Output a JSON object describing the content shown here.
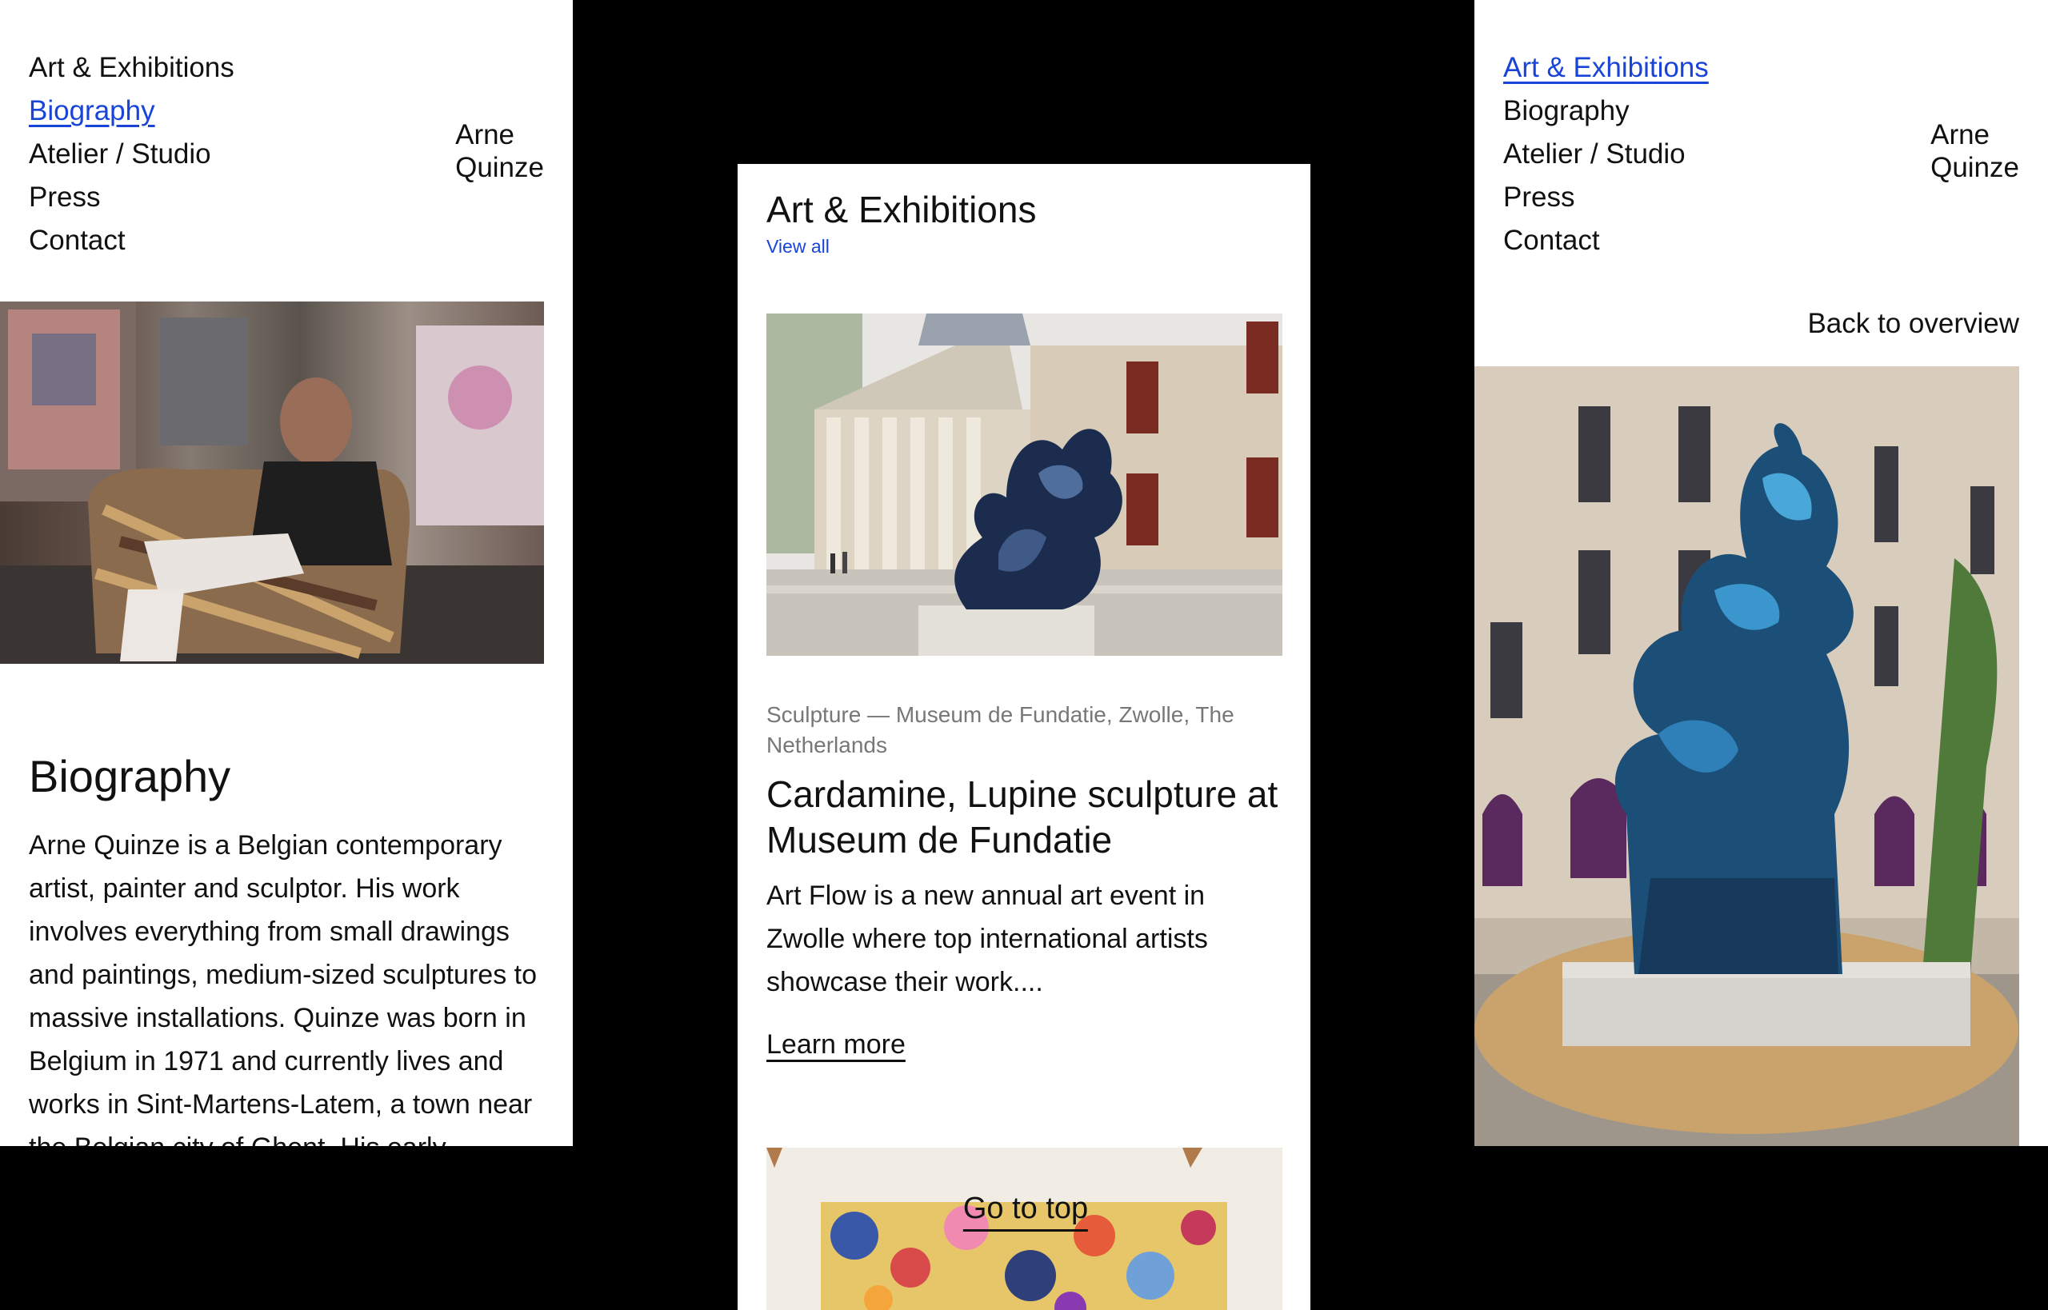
{
  "nav": {
    "items": [
      "Art & Exhibitions",
      "Biography",
      "Atelier / Studio",
      "Press",
      "Contact"
    ]
  },
  "brand": {
    "line1": "Arne",
    "line2": "Quinze"
  },
  "biography": {
    "title": "Biography",
    "text": "Arne Quinze is a Belgian contemporary artist, painter and sculptor. His work involves everything from small drawings and paintings, medium-sized sculptures to massive installations. Quinze was born in Belgium in 1971 and currently lives and works in Sint-Martens-Latem, a town near the Belgian city of Ghent. His early"
  },
  "exhibitions": {
    "title": "Art & Exhibitions",
    "view_all": "View all",
    "card": {
      "meta": "Sculpture — Museum de Fundatie, Zwolle, The Netherlands",
      "title": "Cardamine, Lupine sculpture at Museum de Fundatie",
      "excerpt": "Art Flow is a new annual art event in Zwolle where top international artists showcase their work....",
      "cta": "Learn more"
    },
    "go_to_top": "Go to top"
  },
  "detail": {
    "back": "Back to overview"
  },
  "colors": {
    "link_active": "#1844d9",
    "background": "#000000",
    "panel": "#ffffff",
    "sculpture_blue": "#1f5f8f"
  }
}
